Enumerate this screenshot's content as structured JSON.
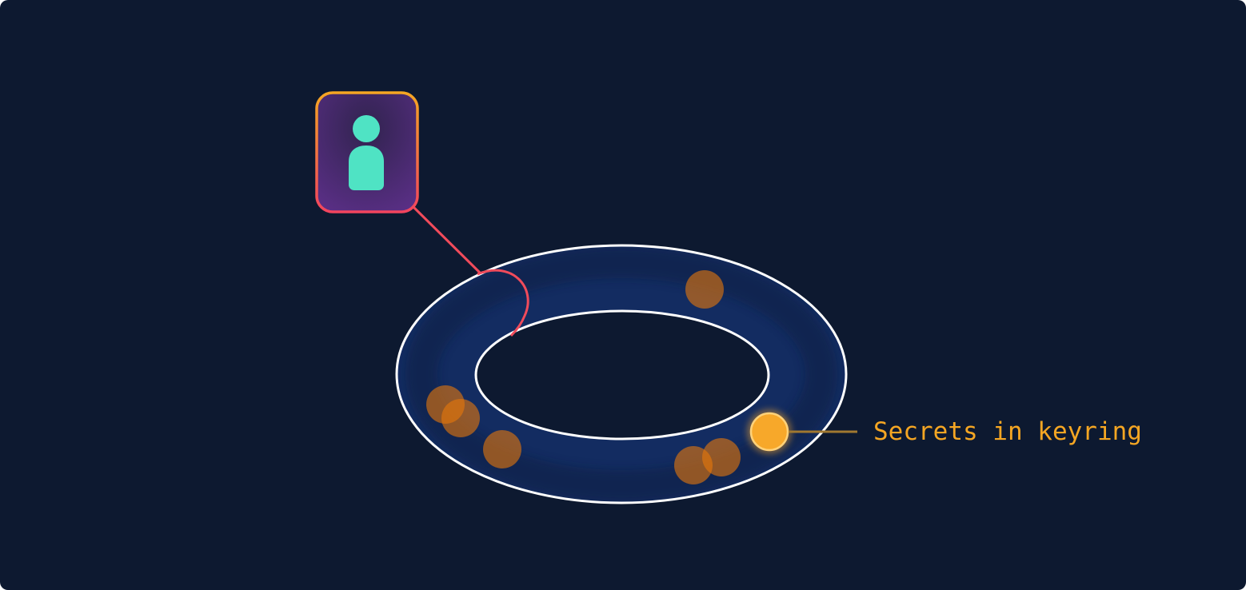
{
  "colors": {
    "background": "#0d1930",
    "ring_fill": "#13264a",
    "ring_stroke": "#ffffff",
    "user_border_top": "#f5a623",
    "user_border_bottom": "#f2445e",
    "user_fill_top": "#5a2f86",
    "user_fill_bottom": "#2a1f4e",
    "user_figure": "#4fe3c4",
    "connector": "#f04b5b",
    "secret_dim": "#e8780a",
    "secret_highlight": "#f7a82a",
    "callout_line": "#a07830",
    "label": "#f5a623"
  },
  "icons": {
    "user": "person-icon"
  },
  "diagram": {
    "user_node_icon": "person-icon",
    "keyring_label": "Secrets in keyring",
    "secret_count": 7
  }
}
